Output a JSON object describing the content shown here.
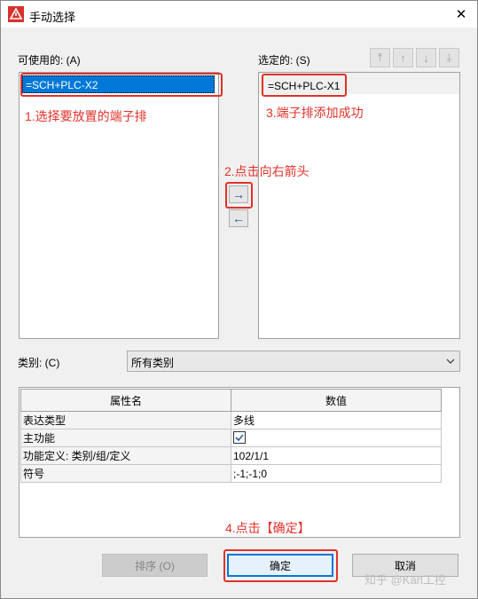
{
  "window": {
    "title": "手动选择",
    "close_symbol": "✕"
  },
  "available": {
    "label": "可使用的: (A)",
    "items": [
      "=SCH+PLC-X2"
    ]
  },
  "selected": {
    "label": "选定的: (S)",
    "items": [
      "=SCH+PLC-X1"
    ]
  },
  "toolbar": {
    "top": "⤒",
    "up": "↑",
    "down": "↓",
    "bottom": "⤓"
  },
  "arrows": {
    "right": "→",
    "left": "←"
  },
  "category": {
    "label": "类别: (C)",
    "value": "所有类别"
  },
  "properties": {
    "headers": [
      "属性名",
      "数值"
    ],
    "rows": [
      {
        "name": "表达类型",
        "value": "多线"
      },
      {
        "name": "主功能",
        "value": "",
        "checked": true
      },
      {
        "name": "功能定义: 类别/组/定义",
        "value": "102/1/1"
      },
      {
        "name": "符号",
        "value": ";-1;-1;0"
      }
    ]
  },
  "buttons": {
    "sort": "排序 (O)",
    "ok": "确定",
    "cancel": "取消"
  },
  "annotations": {
    "step1": "1.选择要放置的端子排",
    "step2": "2.点击向右箭头",
    "step3": "3.端子排添加成功",
    "step4": "4.点击【确定】"
  },
  "watermark": "知乎 @Karl工控",
  "colors": {
    "annotation": "#e0322b",
    "selection": "#0078d7"
  }
}
